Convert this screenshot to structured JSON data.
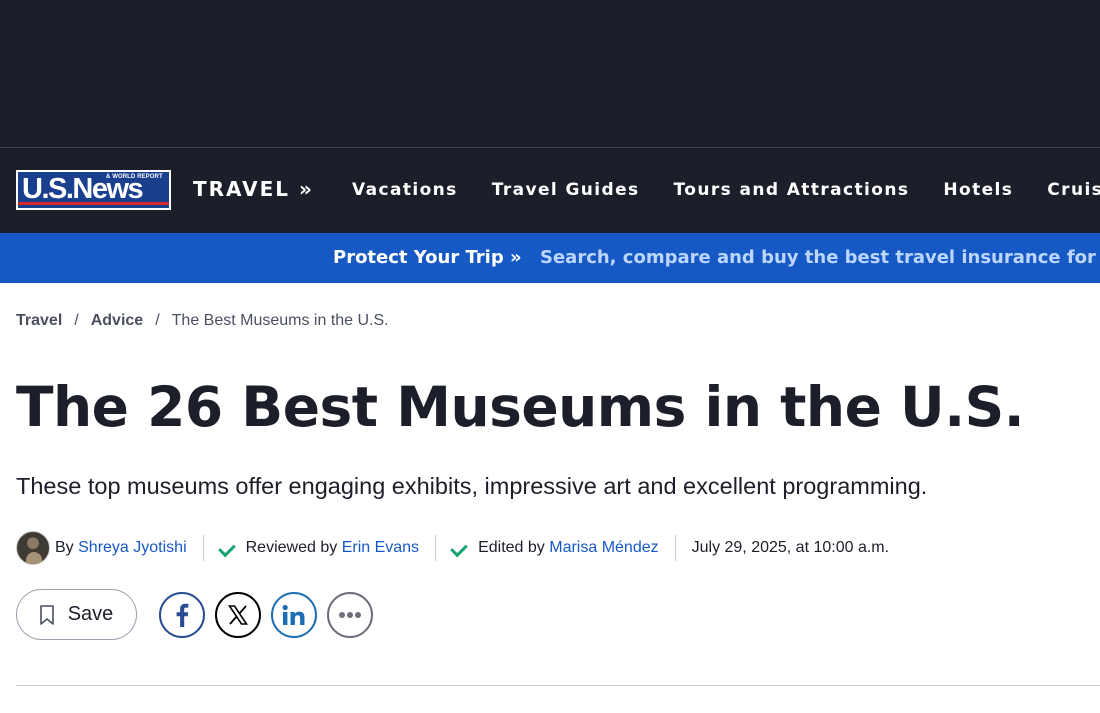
{
  "logo": {
    "main": "U.S.News",
    "small": "& WORLD REPORT"
  },
  "nav": {
    "section": "TRAVEL »",
    "links": [
      "Vacations",
      "Travel Guides",
      "Tours and Attractions",
      "Hotels",
      "Cruises"
    ]
  },
  "promo": {
    "lead": "Protect Your Trip »",
    "text": "Search, compare and buy the best travel insurance for"
  },
  "breadcrumb": {
    "items": [
      "Travel",
      "Advice"
    ],
    "separator": "/",
    "current": "The Best Museums in the U.S."
  },
  "article": {
    "title": "The 26 Best Museums in the U.S.",
    "subtitle": "These top museums offer engaging exhibits, impressive art and excellent programming."
  },
  "byline": {
    "by_prefix": "By",
    "author": "Shreya Jyotishi",
    "reviewed_prefix": "Reviewed by",
    "reviewer": "Erin Evans",
    "edited_prefix": "Edited by",
    "editor": "Marisa Méndez",
    "date": "July 29, 2025, at 10:00 a.m."
  },
  "actions": {
    "save_label": "Save",
    "share": [
      "facebook-icon",
      "x-icon",
      "linkedin-icon",
      "more-icon"
    ]
  },
  "colors": {
    "dark": "#1c1f2a",
    "promo_blue": "#1759c4",
    "link_blue": "#1759c4",
    "check_green": "#17a36b"
  }
}
